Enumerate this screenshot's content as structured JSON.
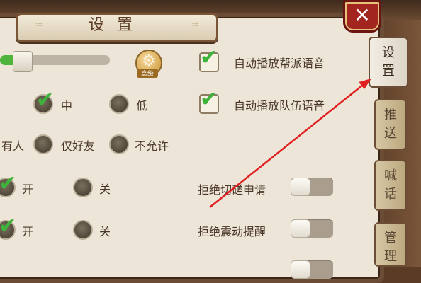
{
  "window": {
    "title": "设置",
    "close_symbol": "✕"
  },
  "audio": {
    "gear_label": "高级",
    "volume_fraction": 0.15
  },
  "checkboxes": [
    {
      "label": "自动播放帮派语音",
      "checked": true
    },
    {
      "label": "自动播放队伍语音",
      "checked": true
    }
  ],
  "quality": {
    "options": [
      {
        "label": "中",
        "checked": true
      },
      {
        "label": "低",
        "checked": false
      }
    ]
  },
  "permission": {
    "partial_label": "有人",
    "options": [
      {
        "label": "仅好友",
        "checked": false
      },
      {
        "label": "不允许",
        "checked": false
      }
    ]
  },
  "row3": {
    "options": [
      {
        "label": "开",
        "checked": true
      },
      {
        "label": "关",
        "checked": false
      }
    ]
  },
  "row4": {
    "options": [
      {
        "label": "开",
        "checked": true
      },
      {
        "label": "关",
        "checked": false
      }
    ]
  },
  "toggles": [
    {
      "label": "拒绝切磋申请",
      "on": false
    },
    {
      "label": "拒绝震动提醒",
      "on": false
    }
  ],
  "side_tabs": [
    {
      "line1": "设",
      "line2": "置",
      "active": true
    },
    {
      "line1": "推",
      "line2": "送",
      "active": false
    },
    {
      "line1": "喊",
      "line2": "话",
      "active": false
    },
    {
      "line1": "管",
      "line2": "理",
      "active": false
    }
  ],
  "colors": {
    "panel_bg": "#ece5d8",
    "check_green": "#3db33a",
    "close_red": "#a32520",
    "annotation_arrow": "#e02020"
  }
}
